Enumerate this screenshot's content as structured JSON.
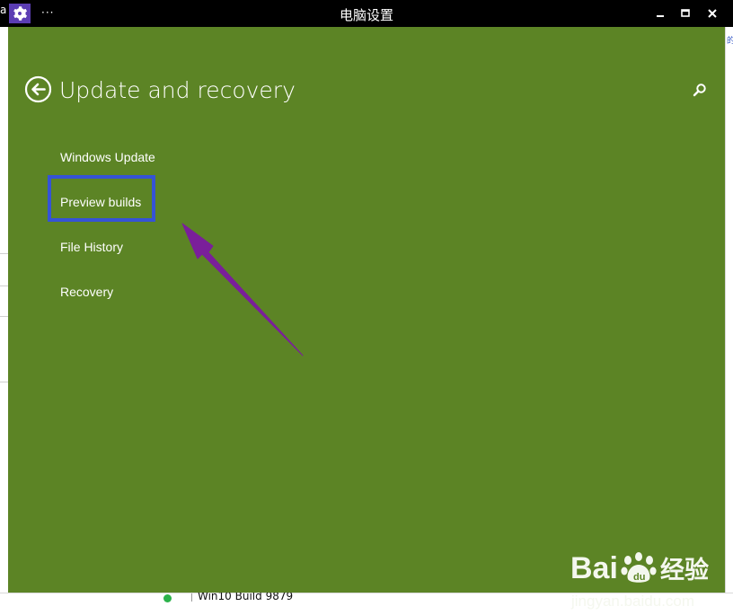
{
  "window": {
    "title": "电脑设置",
    "more_label": "···",
    "corner_char": "a"
  },
  "page": {
    "title": "Update and recovery"
  },
  "nav": {
    "items": [
      {
        "label": "Windows Update"
      },
      {
        "label": "Preview builds"
      },
      {
        "label": "File History"
      },
      {
        "label": "Recovery"
      }
    ],
    "highlighted_item": "Preview builds"
  },
  "background_app": {
    "row_text": "Win10 Build 9879",
    "right_fragment": "的"
  },
  "watermark": {
    "logo": "Bai  经验",
    "site": "jingyan.baidu.com"
  },
  "colors": {
    "window_bg": "#5c8425",
    "titlebar_bg": "#000000",
    "app_icon_bg": "#5b3db3",
    "highlight_border": "#3553d6",
    "annotation_arrow": "#7a1f9a"
  },
  "icons": {
    "app": "gear-icon",
    "back": "back-arrow-circle-icon",
    "search": "search-icon",
    "minimize": "minimize-icon",
    "maximize": "maximize-icon",
    "close": "close-icon"
  }
}
